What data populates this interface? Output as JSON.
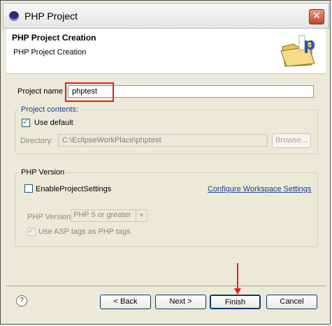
{
  "window": {
    "title": "PHP Project",
    "close_glyph": "✕"
  },
  "header": {
    "title": "PHP Project Creation",
    "subtitle": "PHP Project Creation",
    "icon": "php-folder-icon"
  },
  "project_name": {
    "label": "Project name",
    "value": "phptest"
  },
  "contents": {
    "legend": "Project contents:",
    "use_default": {
      "label": "Use default",
      "checked": true
    },
    "directory": {
      "label": "Directory:",
      "value": "C:\\EclipseWorkPlace\\phptest"
    },
    "browse_label": "Browse..."
  },
  "php_version": {
    "legend": "PHP Version",
    "enable_settings": {
      "label": "EnableProjectSettings",
      "checked": false
    },
    "configure_link": "Configure Workspace Settings",
    "version_label": "PHP Version:",
    "version_value": "PHP 5 or greater",
    "asp_tags": {
      "label": "Use ASP tags as PHP tags",
      "checked": true
    }
  },
  "buttons": {
    "help": "?",
    "back": "< Back",
    "next": "Next >",
    "finish": "Finish",
    "cancel": "Cancel"
  },
  "annotation_color": "#e2231a"
}
